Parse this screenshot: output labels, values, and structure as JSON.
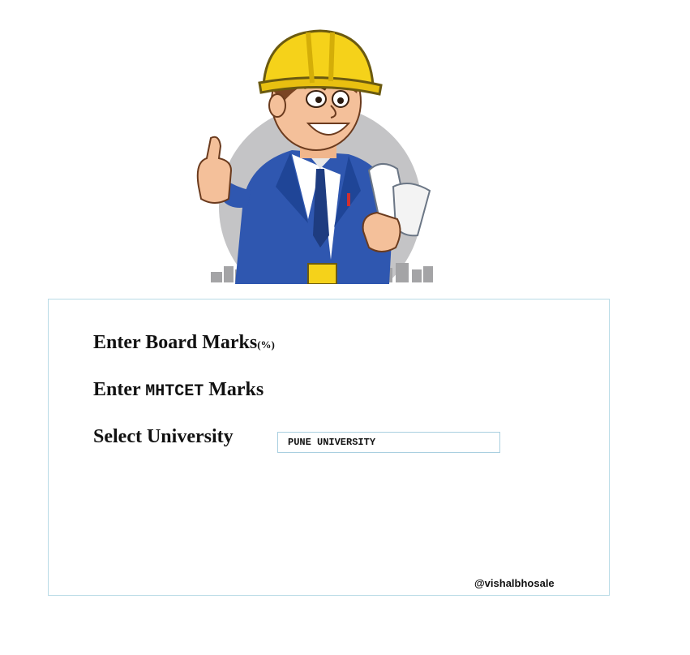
{
  "form": {
    "board_label": "Enter Board Marks",
    "board_suffix": "(%)",
    "cet_prefix": "Enter",
    "cet_exam": "MHTCET",
    "cet_suffix": "Marks",
    "university_label": "Select University",
    "university_value": "PUNE UNIVERSITY"
  },
  "credit": "@vishalbhosale",
  "colors": {
    "panel_border": "#b9dbe6",
    "helmet": "#f5d21a",
    "suit": "#2f57b0"
  }
}
